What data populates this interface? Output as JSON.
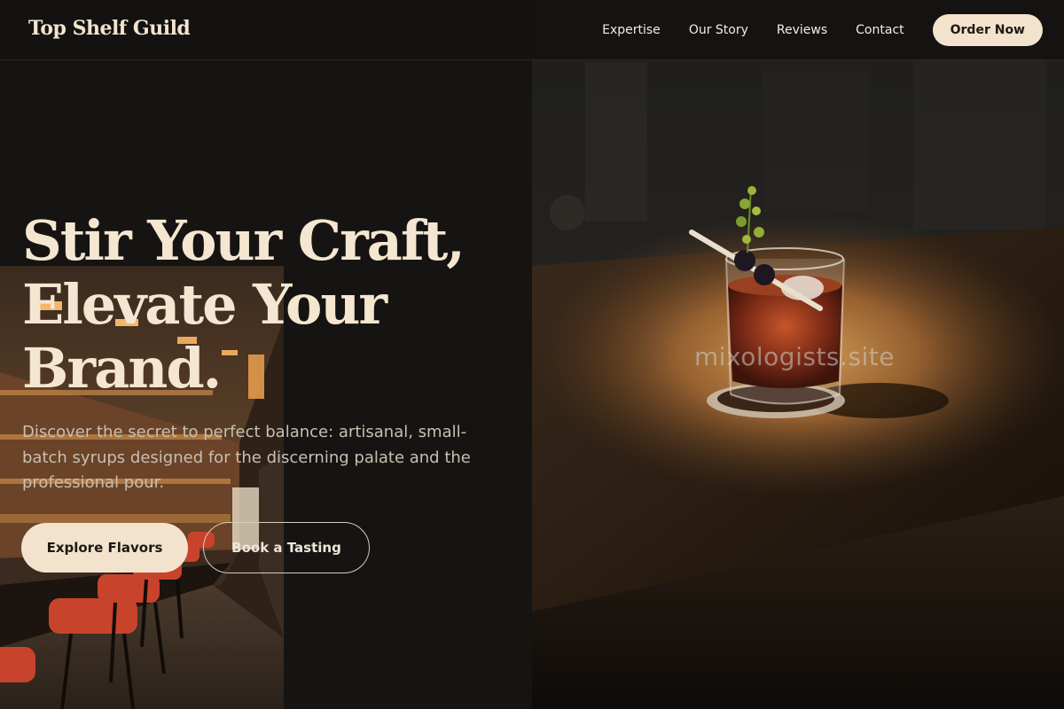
{
  "header": {
    "brand": "Top Shelf Guild",
    "nav": [
      {
        "label": "Expertise"
      },
      {
        "label": "Our Story"
      },
      {
        "label": "Reviews"
      },
      {
        "label": "Contact"
      }
    ],
    "cta_label": "Order Now"
  },
  "hero": {
    "headline_lines": [
      "Stir Your Craft,",
      "Elevate Your",
      "Brand."
    ],
    "subtitle": "Discover the secret to perfect balance: artisanal, small-batch syrups designed for the discerning palate and the professional pour.",
    "primary_button": "Explore Flavors",
    "secondary_button": "Book a Tasting",
    "watermark": "mixologists.site"
  },
  "colors": {
    "background": "#161412",
    "cream": "#f4e3cc",
    "text_light": "#f5e6d1",
    "stool_red": "#c8432c"
  },
  "images": {
    "hero_photo": "cocktail-glass-on-wooden-bar-photo",
    "interior_photo": "bar-interior-with-red-stools-photo"
  }
}
